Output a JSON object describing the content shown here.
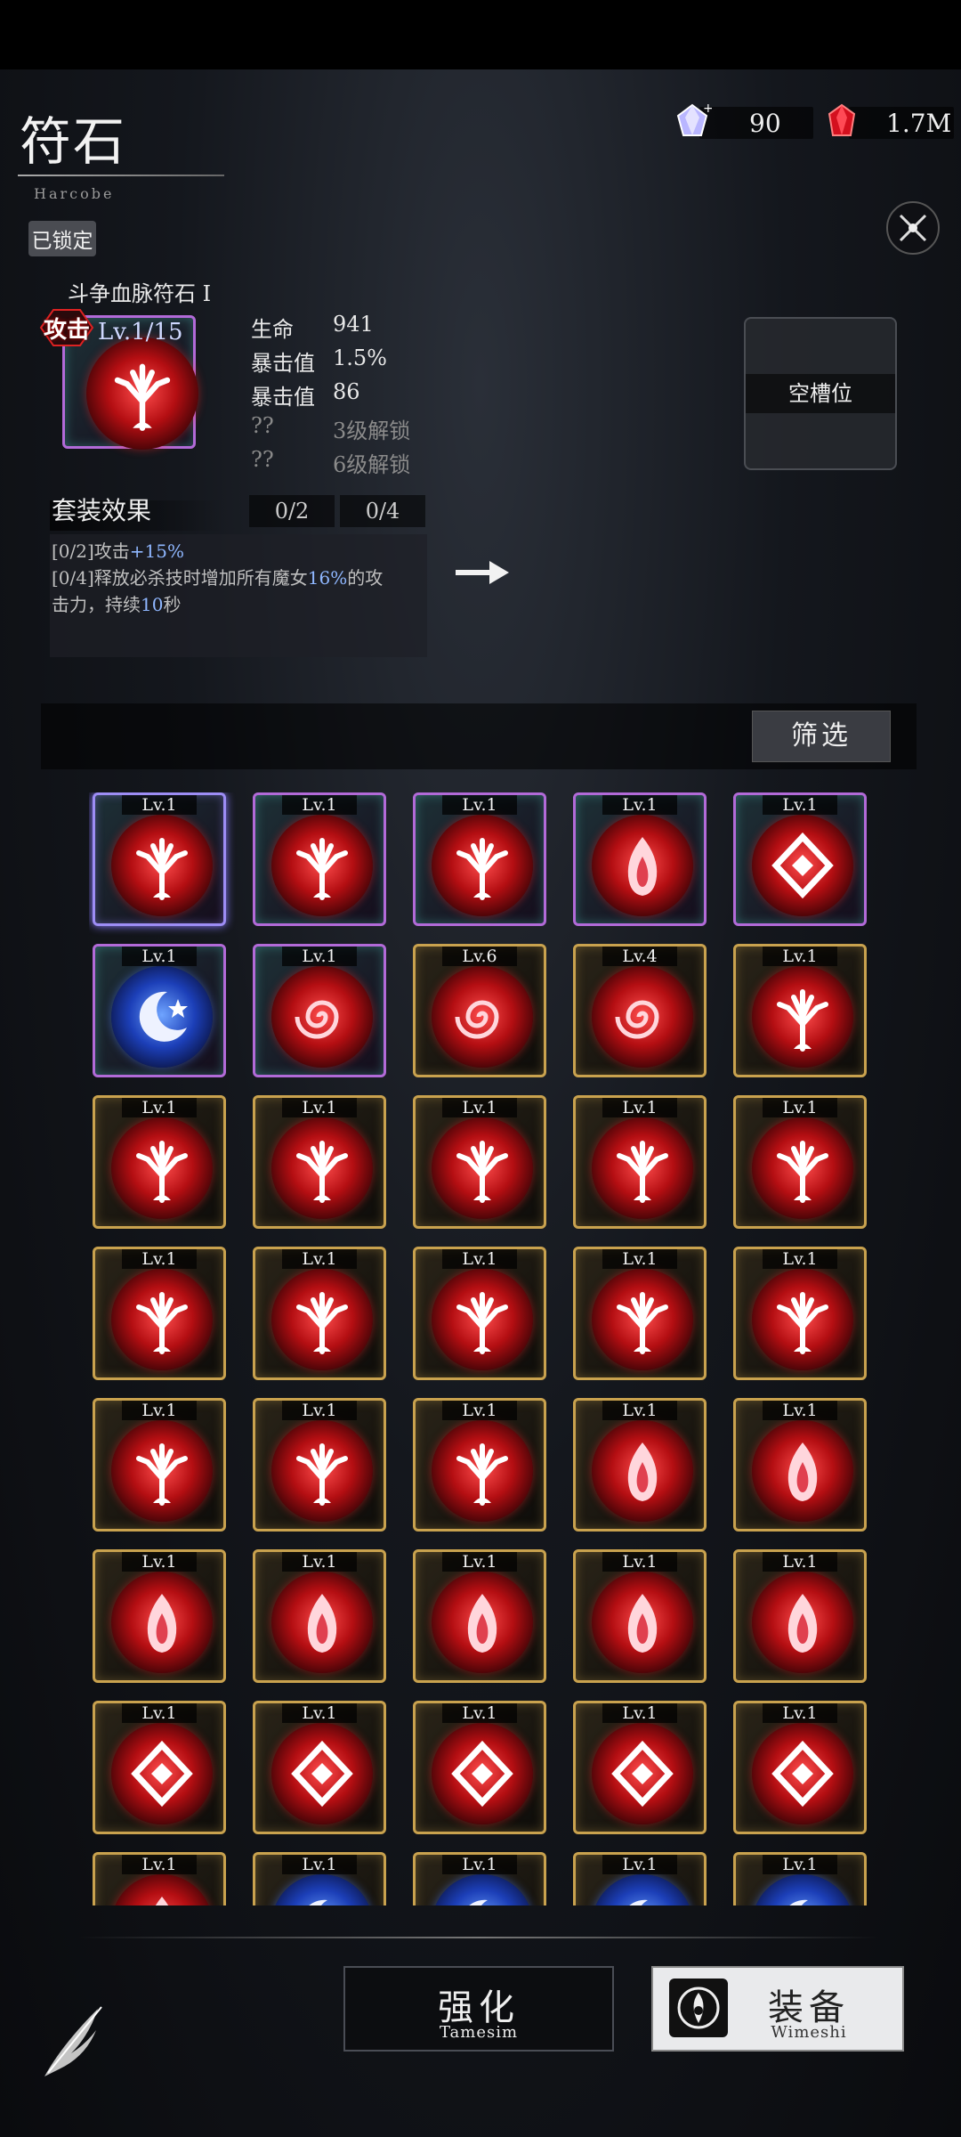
{
  "header": {
    "title": "符石",
    "subtitle": "Harcobe",
    "currency_crystal": "90",
    "currency_ruby": "1.7M"
  },
  "detail": {
    "locked_label": "已锁定",
    "rune_name": "斗争血脉符石 I",
    "type_badge": "攻击",
    "level": "Lv.1/15",
    "stats": [
      {
        "key": "生命",
        "value": "941"
      },
      {
        "key": "暴击值",
        "value": "1.5%"
      },
      {
        "key": "暴击值",
        "value": "86"
      },
      {
        "key": "??",
        "value": "3级解锁"
      },
      {
        "key": "??",
        "value": "6级解锁"
      }
    ],
    "empty_slot_label": "空槽位"
  },
  "set_effect": {
    "title": "套装效果",
    "count_a": "0/2",
    "count_b": "0/4",
    "line1_prefix": "[0/2]攻击",
    "line1_value": "+15%",
    "line2_prefix": "[0/4]释放必杀技时增加所有魔女",
    "line2_value": "16%",
    "line2_suffix": "的攻",
    "line3_prefix": "击力，持续",
    "line3_value": "10",
    "line3_suffix": "秒"
  },
  "filter": {
    "label": "筛选"
  },
  "grid": {
    "items": [
      {
        "level": "Lv.1",
        "icon": "tree",
        "frame": "purple",
        "selected": true
      },
      {
        "level": "Lv.1",
        "icon": "tree",
        "frame": "purple"
      },
      {
        "level": "Lv.1",
        "icon": "tree",
        "frame": "purple"
      },
      {
        "level": "Lv.1",
        "icon": "flame",
        "frame": "purple"
      },
      {
        "level": "Lv.1",
        "icon": "diamond",
        "frame": "purple"
      },
      {
        "level": "Lv.1",
        "icon": "moon",
        "frame": "purple",
        "orb": "blue"
      },
      {
        "level": "Lv.1",
        "icon": "spiral",
        "frame": "purple"
      },
      {
        "level": "Lv.6",
        "icon": "spiral",
        "frame": "gold"
      },
      {
        "level": "Lv.4",
        "icon": "spiral",
        "frame": "gold"
      },
      {
        "level": "Lv.1",
        "icon": "tree",
        "frame": "gold"
      },
      {
        "level": "Lv.1",
        "icon": "tree",
        "frame": "gold"
      },
      {
        "level": "Lv.1",
        "icon": "tree",
        "frame": "gold"
      },
      {
        "level": "Lv.1",
        "icon": "tree",
        "frame": "gold"
      },
      {
        "level": "Lv.1",
        "icon": "tree",
        "frame": "gold"
      },
      {
        "level": "Lv.1",
        "icon": "tree",
        "frame": "gold"
      },
      {
        "level": "Lv.1",
        "icon": "tree",
        "frame": "gold"
      },
      {
        "level": "Lv.1",
        "icon": "tree",
        "frame": "gold"
      },
      {
        "level": "Lv.1",
        "icon": "tree",
        "frame": "gold"
      },
      {
        "level": "Lv.1",
        "icon": "tree",
        "frame": "gold"
      },
      {
        "level": "Lv.1",
        "icon": "tree",
        "frame": "gold"
      },
      {
        "level": "Lv.1",
        "icon": "tree",
        "frame": "gold"
      },
      {
        "level": "Lv.1",
        "icon": "tree",
        "frame": "gold"
      },
      {
        "level": "Lv.1",
        "icon": "tree",
        "frame": "gold"
      },
      {
        "level": "Lv.1",
        "icon": "flame",
        "frame": "gold"
      },
      {
        "level": "Lv.1",
        "icon": "flame",
        "frame": "gold"
      },
      {
        "level": "Lv.1",
        "icon": "flame",
        "frame": "gold"
      },
      {
        "level": "Lv.1",
        "icon": "flame",
        "frame": "gold"
      },
      {
        "level": "Lv.1",
        "icon": "flame",
        "frame": "gold"
      },
      {
        "level": "Lv.1",
        "icon": "flame",
        "frame": "gold"
      },
      {
        "level": "Lv.1",
        "icon": "flame",
        "frame": "gold"
      },
      {
        "level": "Lv.1",
        "icon": "diamond",
        "frame": "gold"
      },
      {
        "level": "Lv.1",
        "icon": "diamond",
        "frame": "gold"
      },
      {
        "level": "Lv.1",
        "icon": "diamond",
        "frame": "gold"
      },
      {
        "level": "Lv.1",
        "icon": "diamond",
        "frame": "gold"
      },
      {
        "level": "Lv.1",
        "icon": "diamond",
        "frame": "gold"
      },
      {
        "level": "Lv.1",
        "icon": "flame",
        "frame": "gold"
      },
      {
        "level": "Lv.1",
        "icon": "moon",
        "frame": "gold",
        "orb": "blue"
      },
      {
        "level": "Lv.1",
        "icon": "moon",
        "frame": "gold",
        "orb": "blue"
      },
      {
        "level": "Lv.1",
        "icon": "moon",
        "frame": "gold",
        "orb": "blue"
      },
      {
        "level": "Lv.1",
        "icon": "moon",
        "frame": "gold",
        "orb": "blue"
      }
    ]
  },
  "actions": {
    "upgrade_label": "强化",
    "upgrade_sub": "Tamesim",
    "equip_label": "装备",
    "equip_sub": "Wimeshi"
  },
  "colors": {
    "gold_frame": "#c9a24e",
    "purple_frame": "#b26ad8",
    "highlight_blue": "#8fb7ff"
  }
}
